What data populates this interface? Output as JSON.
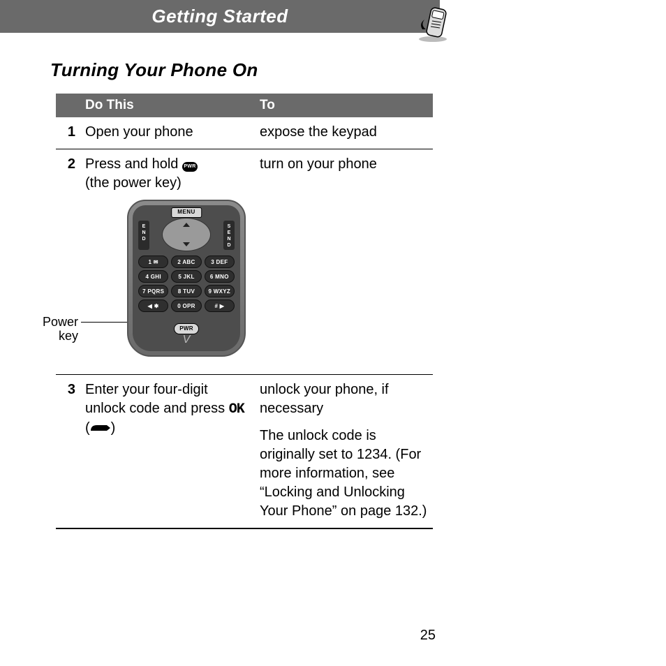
{
  "header": {
    "title": "Getting Started"
  },
  "section": {
    "title": "Turning Your Phone On"
  },
  "table": {
    "headers": {
      "col1": "Do This",
      "col2": "To"
    },
    "rows": [
      {
        "num": "1",
        "do": "Open your phone",
        "to": "expose the keypad"
      },
      {
        "num": "2",
        "do_pre": "Press and hold ",
        "pwr_icon_label": "PWR",
        "do_post": " (the power key)",
        "to": "turn on your phone",
        "callout": "Power key",
        "callout_line1": "Power",
        "callout_line2": "key",
        "phone": {
          "menu": "MENU",
          "end": "E\nN\nD",
          "send": "S\nE\nN\nD",
          "keys": [
            "1 ✉",
            "2 ABC",
            "3 DEF",
            "4 GHI",
            "5 JKL",
            "6 MNO",
            "7 PQRS",
            "8 TUV",
            "9 WXYZ",
            "◀ ✱",
            "0 OPR",
            "# ▶"
          ],
          "pwr": "PWR",
          "signature": "V"
        }
      },
      {
        "num": "3",
        "do_pre": "Enter your four-digit unlock code and press ",
        "ok_label": "OK",
        "do_post": ")",
        "to": "unlock your phone, if necessary",
        "to_detail": "The unlock code is originally set to 1234. (For more information, see “Locking and Unlocking Your Phone” on page 132.)"
      }
    ]
  },
  "page_number": "25"
}
